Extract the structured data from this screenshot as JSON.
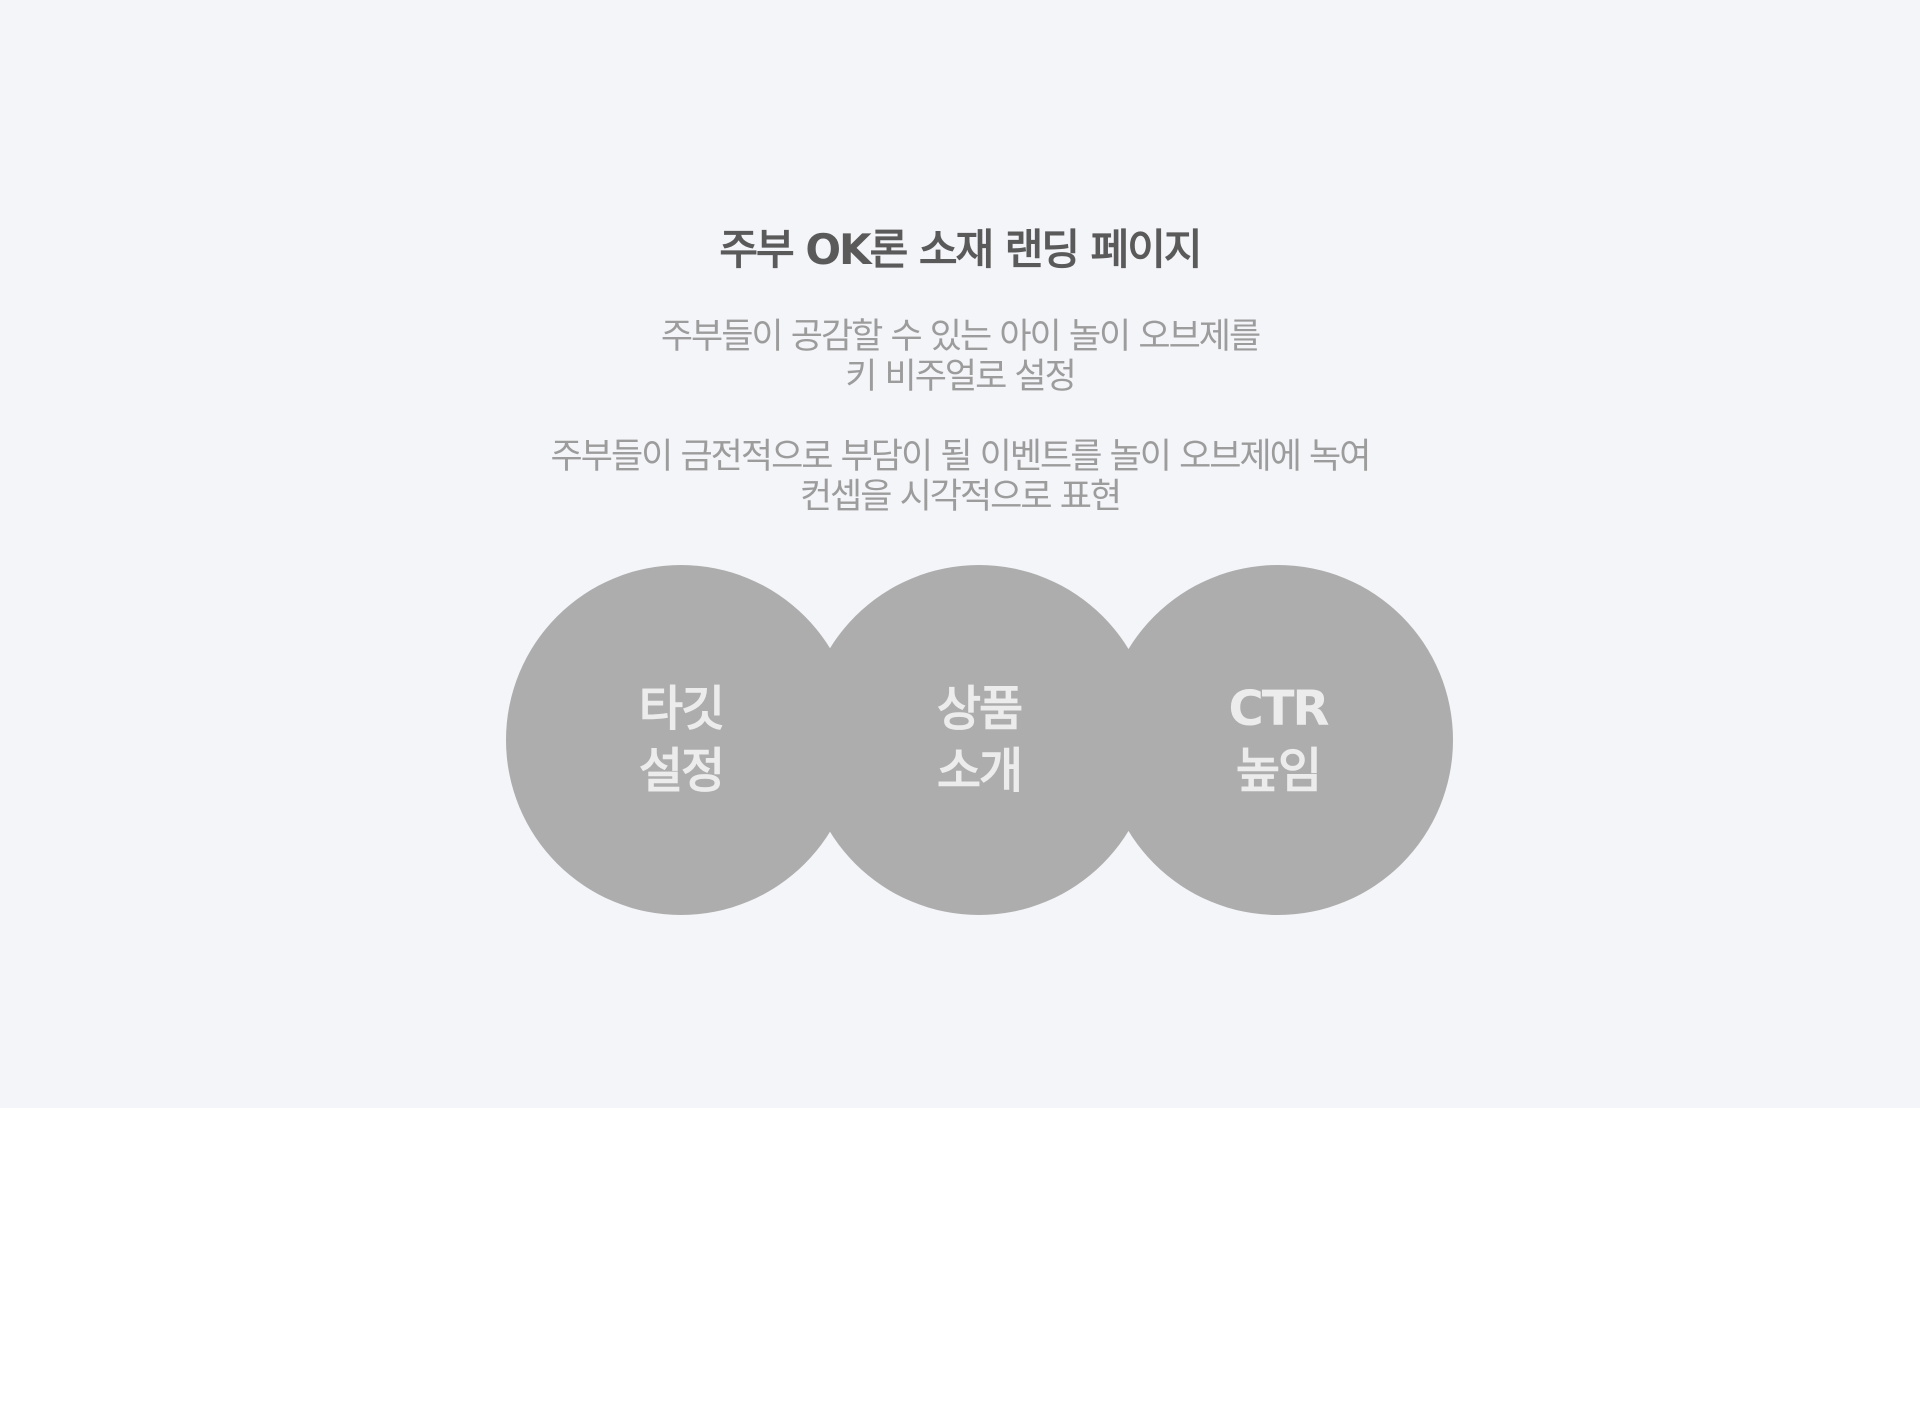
{
  "title": "주부 OK론 소재 랜딩 페이지",
  "description": [
    {
      "line1": "주부들이 공감할 수 있는 아이 놀이 오브제를",
      "line2": "키 비주얼로 설정"
    },
    {
      "line1": "주부들이 금전적으로 부담이 될 이벤트를 놀이 오브제에 녹여",
      "line2": "컨셉을 시각적으로 표현"
    }
  ],
  "circles": [
    {
      "line1": "타깃",
      "line2": "설정"
    },
    {
      "line1": "상품",
      "line2": "소개"
    },
    {
      "line1": "CTR",
      "line2": "높임"
    }
  ],
  "colors": {
    "section_background": "#f4f5f9",
    "page_background": "#ffffff",
    "circle_fill": "#adadad",
    "circle_text": "#ececec",
    "title_text": "#5a5a5a",
    "body_text": "#9c9c9c"
  }
}
